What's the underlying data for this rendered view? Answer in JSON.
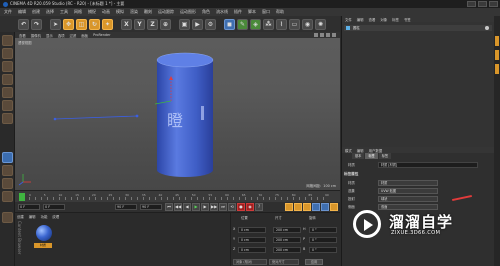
{
  "app": {
    "title": "CINEMA 4D R20.059 Studio (RC - R20) - [未标题 1 *] - 主要"
  },
  "menubar": {
    "items": [
      "文件",
      "编辑",
      "创建",
      "选择",
      "工具",
      "网格",
      "捕捉",
      "动画",
      "模拟",
      "渲染",
      "雕刻",
      "运动跟踪",
      "运动图形",
      "角色",
      "流水线",
      "插件",
      "脚本",
      "窗口",
      "帮助"
    ]
  },
  "toolbar": {
    "axis_labels": [
      "X",
      "Y",
      "Z"
    ]
  },
  "viewport": {
    "menu": [
      "查看",
      "摄像机",
      "显示",
      "选项",
      "过滤",
      "面板",
      "ProRender"
    ],
    "label": "透视视图",
    "grid_status": "网格间距：100 cm",
    "cylinder_text": "瞪"
  },
  "timeline": {
    "ticks": [
      "0",
      "5",
      "10",
      "15",
      "20",
      "25",
      "30",
      "35",
      "40",
      "45",
      "50",
      "55",
      "60",
      "65",
      "70",
      "75",
      "80",
      "85",
      "90"
    ],
    "current_frame": "0 F",
    "start_frame": "0 F",
    "end_frame": "90 F",
    "end_frame_2": "90 F"
  },
  "materials": {
    "tabs": [
      "创建",
      "编辑",
      "功能",
      "纹理"
    ],
    "item_label": "材质",
    "side_label": "Content Browser"
  },
  "coordinates": {
    "headers": [
      "位置",
      "尺寸",
      "旋转"
    ],
    "rows": [
      {
        "axis": "X",
        "pos": "0 cm",
        "size": "200 cm",
        "rot_label": "H",
        "rot": "0 °"
      },
      {
        "axis": "Y",
        "pos": "0 cm",
        "size": "200 cm",
        "rot_label": "P",
        "rot": "0 °"
      },
      {
        "axis": "Z",
        "pos": "0 cm",
        "size": "200 cm",
        "rot_label": "B",
        "rot": "0 °"
      }
    ],
    "mode": "对象 (相对)",
    "size_mode": "绝对尺寸",
    "apply": "应用"
  },
  "object_manager": {
    "tabs": [
      "文件",
      "编辑",
      "查看",
      "对象",
      "标签",
      "书签"
    ],
    "objects": [
      {
        "name": "圆柱"
      }
    ]
  },
  "attributes": {
    "menu": [
      "模式",
      "编辑",
      "用户数据"
    ],
    "tabs": [
      "基本",
      "标签",
      "标签"
    ],
    "object_label": "材质",
    "object_value": "材质 [材质]",
    "section": "标签属性",
    "rows": [
      {
        "label": "材质",
        "value": "材质"
      },
      {
        "label": "选集",
        "value": "UVW 贴图"
      },
      {
        "label": "投射",
        "value": "球状"
      },
      {
        "label": "侧面",
        "value": "双面"
      }
    ]
  },
  "watermark": {
    "name": "溜溜自学",
    "url": "ZIXUE.3D66.COM"
  },
  "colors": {
    "accent": "#d9962a",
    "selected_blue": "#3f6fb0",
    "cylinder": "#4664c8",
    "x_axis": "#e23b3b",
    "y_axis": "#3fb540",
    "z_axis": "#3b5fe2"
  }
}
